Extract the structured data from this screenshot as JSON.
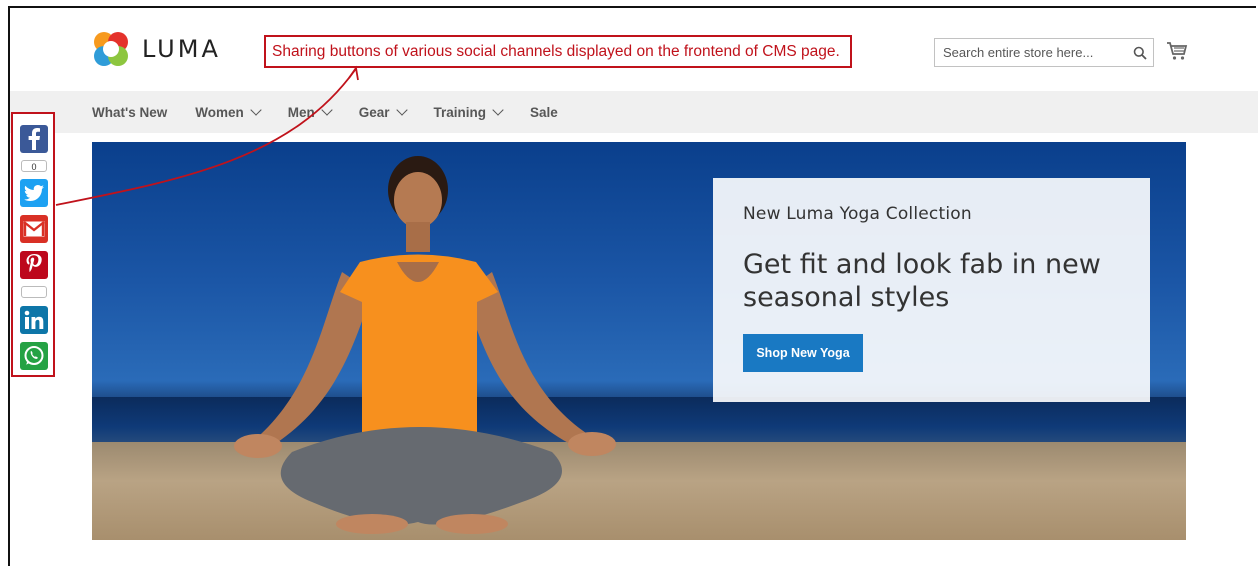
{
  "brand": {
    "name": "LUMA"
  },
  "annotation": {
    "text": "Sharing buttons of various social channels displayed on the frontend of CMS page."
  },
  "search": {
    "placeholder": "Search entire store here..."
  },
  "nav": {
    "items": [
      {
        "label": "What's New",
        "dropdown": false
      },
      {
        "label": "Women",
        "dropdown": true
      },
      {
        "label": "Men",
        "dropdown": true
      },
      {
        "label": "Gear",
        "dropdown": true
      },
      {
        "label": "Training",
        "dropdown": true
      },
      {
        "label": "Sale",
        "dropdown": false
      }
    ]
  },
  "social": {
    "buttons": [
      {
        "name": "facebook",
        "icon": "facebook-icon",
        "color": "#3b5998"
      },
      {
        "name": "twitter",
        "icon": "twitter-icon",
        "color": "#1da1f2"
      },
      {
        "name": "gmail",
        "icon": "gmail-icon",
        "color": "#d93025"
      },
      {
        "name": "pinterest",
        "icon": "pinterest-icon",
        "color": "#bd081c"
      },
      {
        "name": "linkedin",
        "icon": "linkedin-icon",
        "color": "#0e76a8"
      },
      {
        "name": "whatsapp",
        "icon": "whatsapp-icon",
        "color": "#25a244"
      }
    ],
    "facebook_count": "0",
    "pinterest_count": ""
  },
  "promo": {
    "subtitle": "New Luma Yoga Collection",
    "title": "Get fit and look fab in new seasonal styles",
    "button_label": "Shop New Yoga"
  },
  "colors": {
    "annotation": "#c0121b",
    "primary_button": "#1979c3",
    "nav_background": "#f0f0f0"
  }
}
